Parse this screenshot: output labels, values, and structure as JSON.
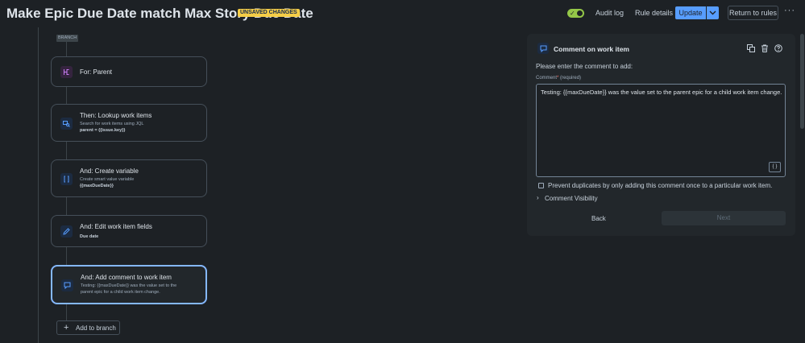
{
  "header": {
    "title": "Make Epic Due Date match Max Story Due Date",
    "badge": "UNSAVED CHANGES",
    "audit_log": "Audit log",
    "rule_details": "Rule details",
    "update": "Update",
    "return_to_rules": "Return to rules",
    "more": "···"
  },
  "colors": {
    "toggle_on": "#94c748",
    "primary": "#579dff",
    "selected_border": "#85b8ff",
    "badge": "#f5cd47"
  },
  "flow": {
    "branch_tag": "BRANCH",
    "cards": [
      {
        "icon": "branch-icon",
        "title": "For: Parent"
      },
      {
        "icon": "lookup-icon",
        "title": "Then: Lookup work items",
        "sub": "Search for work items using JQL",
        "sub2": "parent = {{issue.key}}"
      },
      {
        "icon": "variable-icon",
        "title": "And: Create variable",
        "sub": "Create smart value variable",
        "sub2": "{{maxDueDate}}"
      },
      {
        "icon": "edit-icon",
        "title": "And: Edit work item fields",
        "sub2": "Due date"
      },
      {
        "icon": "comment-icon",
        "title": "And: Add comment to work item",
        "sub": "Testing: {{maxDueDate}} was the value set to the",
        "sub3": "parent epic for a child work item change."
      }
    ],
    "add_to_branch": "Add to branch"
  },
  "panel": {
    "title": "Comment on work item",
    "prompt": "Please enter the comment to add:",
    "field_label": "Comment",
    "required_mark": "*",
    "required_text": "(required)",
    "comment_value": "Testing: {{maxDueDate}} was the value set to the parent epic for a child work item change.",
    "smart_value_button": "{ }",
    "prevent_duplicates": "Prevent duplicates by only adding this comment once to a particular work item.",
    "visibility": "Comment Visibility",
    "back": "Back",
    "next": "Next"
  }
}
